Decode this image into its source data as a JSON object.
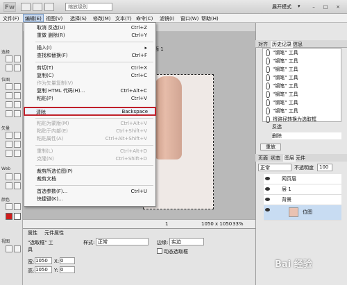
{
  "titlebar": {
    "logo": "Fw",
    "zoom_value": "缩放级别",
    "mode": "展开模式",
    "min": "–",
    "max": "□",
    "close": "×"
  },
  "menubar": {
    "items": [
      "文件(F)",
      "编辑(E)",
      "视图(V)",
      "选择(S)",
      "修改(M)",
      "文本(T)",
      "命令(C)",
      "滤镜(I)",
      "窗口(W)",
      "帮助(H)"
    ]
  },
  "edit_menu": {
    "items": [
      {
        "label": "取消 反选(U)",
        "shortcut": "Ctrl+Z",
        "disabled": false
      },
      {
        "label": "重做 删除(R)",
        "shortcut": "Ctrl+Y",
        "disabled": false
      },
      {
        "label": "插入(I)",
        "shortcut": "",
        "disabled": false
      },
      {
        "label": "查找和替换(F)",
        "shortcut": "Ctrl+F",
        "disabled": false
      },
      {
        "label": "剪切(T)",
        "shortcut": "Ctrl+X",
        "disabled": false
      },
      {
        "label": "复制(C)",
        "shortcut": "Ctrl+C",
        "disabled": false
      },
      {
        "label": "作为矢量复制(V)",
        "shortcut": "",
        "disabled": true
      },
      {
        "label": "复制 HTML 代码(H)...",
        "shortcut": "Ctrl+Alt+C",
        "disabled": false
      },
      {
        "label": "粘贴(P)",
        "shortcut": "Ctrl+V",
        "disabled": false
      },
      {
        "label": "清除",
        "shortcut": "Backspace",
        "disabled": false
      },
      {
        "label": "粘贴为蒙版(M)",
        "shortcut": "Ctrl+Alt+V",
        "disabled": true
      },
      {
        "label": "粘贴于内部(E)",
        "shortcut": "Ctrl+Shift+V",
        "disabled": true
      },
      {
        "label": "粘贴属性(A)",
        "shortcut": "Ctrl+Alt+Shift+V",
        "disabled": true
      },
      {
        "label": "重制(L)",
        "shortcut": "Ctrl+Alt+D",
        "disabled": true
      },
      {
        "label": "克隆(N)",
        "shortcut": "Ctrl+Shift+D",
        "disabled": true
      },
      {
        "label": "裁剪所选位图(P)",
        "shortcut": "",
        "disabled": false
      },
      {
        "label": "裁剪文档",
        "shortcut": "",
        "disabled": false
      },
      {
        "label": "首选参数(F)...",
        "shortcut": "Ctrl+U",
        "disabled": false
      },
      {
        "label": "快捷键(K)...",
        "shortcut": "",
        "disabled": false
      }
    ]
  },
  "tools": {
    "select": "选择",
    "bitmap": "位图",
    "vector": "矢量",
    "web": "Web",
    "colors": "颜色",
    "view": "视图"
  },
  "document": {
    "tab": "页面 1"
  },
  "statusbar": {
    "page": "1",
    "size": "1050 x 1050",
    "zoom": "33%"
  },
  "properties": {
    "tab_props": "属性",
    "tab_symbol": "元件属性",
    "tool_name": "\"选取框\" 工具",
    "style_label": "样式:",
    "style_value": "正常",
    "edge_label": "边缘:",
    "edge_value": "实边",
    "dynamic_marquee": "动态选取框",
    "w_label": "宽:",
    "w_value": "1050",
    "h_label": "高:",
    "h_value": "1050",
    "x_label": "X:",
    "x_value": "0",
    "y_label": "Y:",
    "y_value": "0"
  },
  "right_panel": {
    "tabs": [
      "对齐",
      "历史记录",
      "信息"
    ],
    "history": [
      "\"钢笔\" 工具",
      "\"钢笔\" 工具",
      "\"钢笔\" 工具",
      "\"钢笔\" 工具",
      "\"钢笔\" 工具",
      "\"钢笔\" 工具",
      "\"钢笔\" 工具",
      "\"钢笔\" 工具",
      "将路径转换为选取框",
      "反选",
      "删除"
    ],
    "replay_btn": "重放",
    "layer_tabs": [
      "页面",
      "状态",
      "图层",
      "元件"
    ],
    "blend_mode": "正常",
    "opacity_label": "不透明度",
    "opacity_value": "100",
    "layers": [
      "网页层",
      "层 1",
      "背景",
      "位图"
    ]
  },
  "watermark": "Bai 经验"
}
